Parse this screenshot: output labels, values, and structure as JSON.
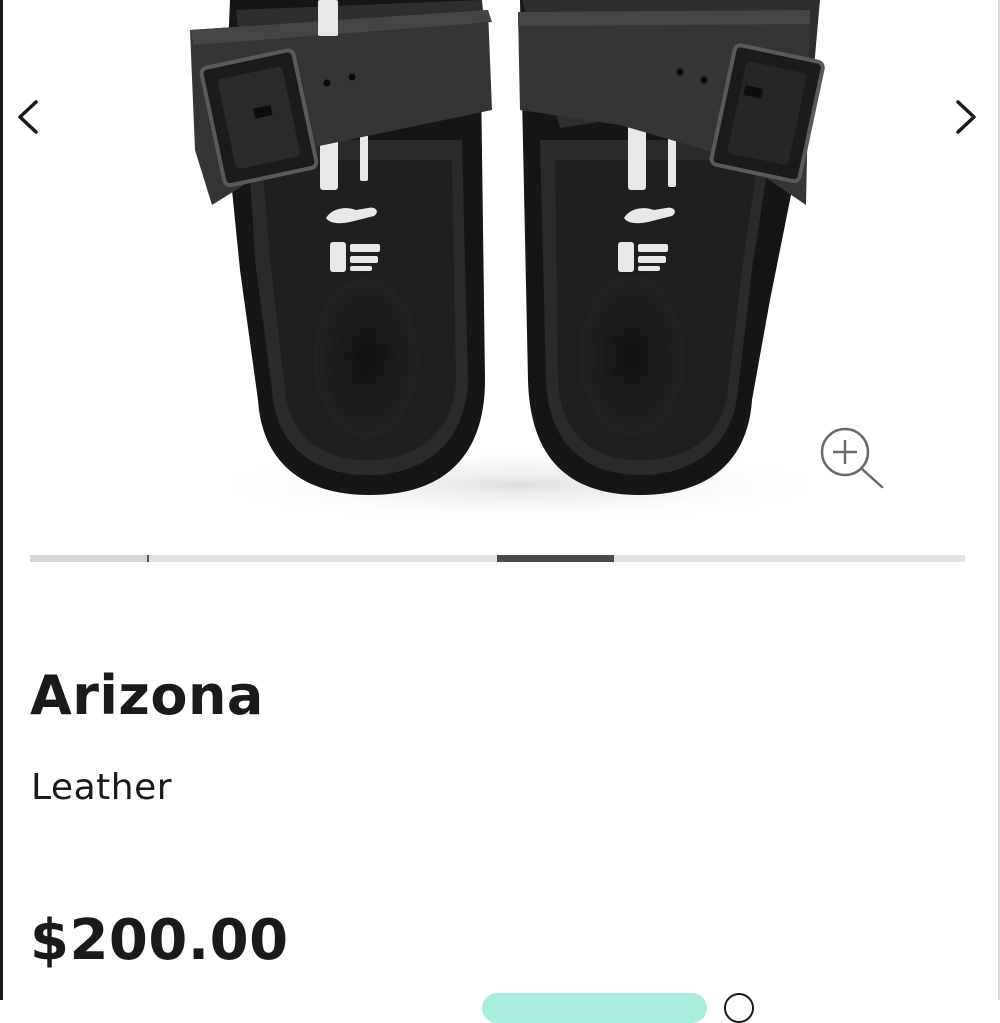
{
  "gallery": {
    "image_alt": "Product photo",
    "prev_icon": "chevron-left-icon",
    "next_icon": "chevron-right-icon",
    "zoom_icon": "zoom-in-icon",
    "current_index": 5,
    "total_images": 8
  },
  "product": {
    "name": "Arizona",
    "material": "Leather",
    "price": "$200.00"
  },
  "colors": {
    "text": "#1a1a1a",
    "progress_track": "#e2e2e2",
    "progress_active": "#4a4a4a",
    "promo_pill": "#a8eedf"
  }
}
